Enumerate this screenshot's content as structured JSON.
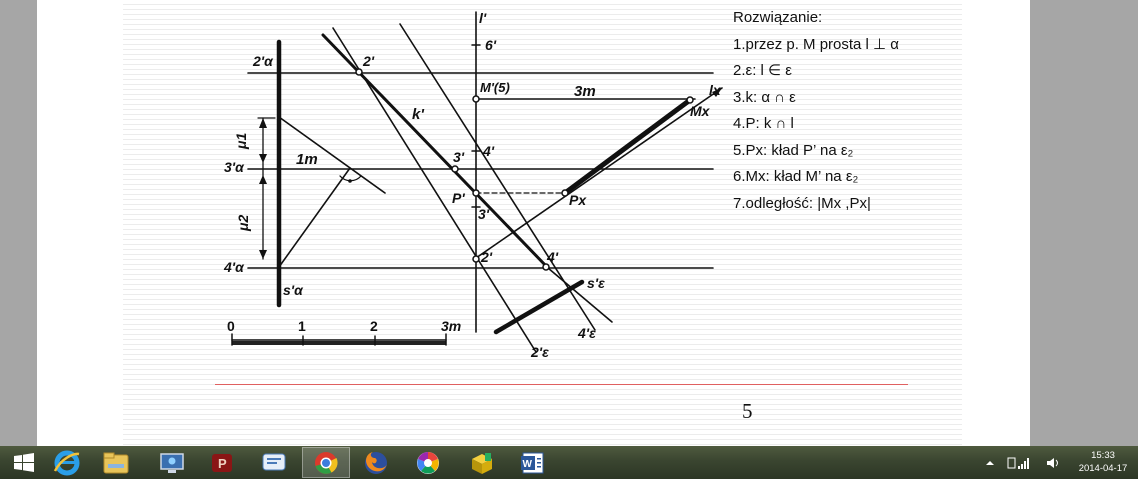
{
  "solution": {
    "heading": "Rozwiązanie:",
    "steps": [
      "1.przez p. M prosta l ⊥ α",
      "2.ε: l ∈ ε",
      "3.k: α ∩ ε",
      "4.P: k ∩ l",
      "5.Px: kład P’ na ε₂",
      "6.Mx: kład M’ na ε₂",
      "7.odległość:  |Mx ,Px|"
    ]
  },
  "drawing": {
    "labels": {
      "l_prime": "l'",
      "six_prime": "6'",
      "two_alpha": "2'α",
      "two_prime_top": "2'",
      "m_prime": "M'(5)",
      "three_m_top": "3m",
      "l_x": "lx",
      "m_x": "Mx",
      "k_prime": "k'",
      "mu1": "μ1",
      "three_prime": "3'",
      "four_prime_top": "4'",
      "three_alpha": "3'α",
      "one_m": "1m",
      "p_prime": "P'",
      "p_x": "Px",
      "three_prime_low": "3'",
      "mu2": "μ2",
      "two_prime_low": "2'",
      "four_prime_low": "4'",
      "four_alpha": "4'α",
      "s_alpha": "s'α",
      "s_eps": "s'ε",
      "four_eps": "4'ε",
      "two_eps": "2'ε"
    },
    "scale": {
      "ticks": [
        "0",
        "1",
        "2",
        "3m"
      ]
    }
  },
  "page_number": "5",
  "taskbar": {
    "apps": [
      {
        "name": "start-button",
        "icon": "windows-logo-icon"
      },
      {
        "name": "internet-explorer",
        "icon": "ie-icon"
      },
      {
        "name": "file-explorer",
        "icon": "folder-icon"
      },
      {
        "name": "remote-desktop",
        "icon": "monitor-icon"
      },
      {
        "name": "powerpoint",
        "icon": "powerpoint-icon"
      },
      {
        "name": "messenger",
        "icon": "chat-icon"
      },
      {
        "name": "chrome",
        "icon": "chrome-icon"
      },
      {
        "name": "firefox",
        "icon": "firefox-icon"
      },
      {
        "name": "picasa",
        "icon": "picasa-icon"
      },
      {
        "name": "package-tool",
        "icon": "box-icon"
      },
      {
        "name": "word",
        "icon": "word-icon"
      }
    ],
    "active_app": "chrome",
    "clock": {
      "time": "15:33",
      "date": "2014-04-17"
    }
  },
  "colors": {
    "taskbar": "#36422c",
    "scale_bar": "#222222",
    "red_rule": "#e06060"
  }
}
